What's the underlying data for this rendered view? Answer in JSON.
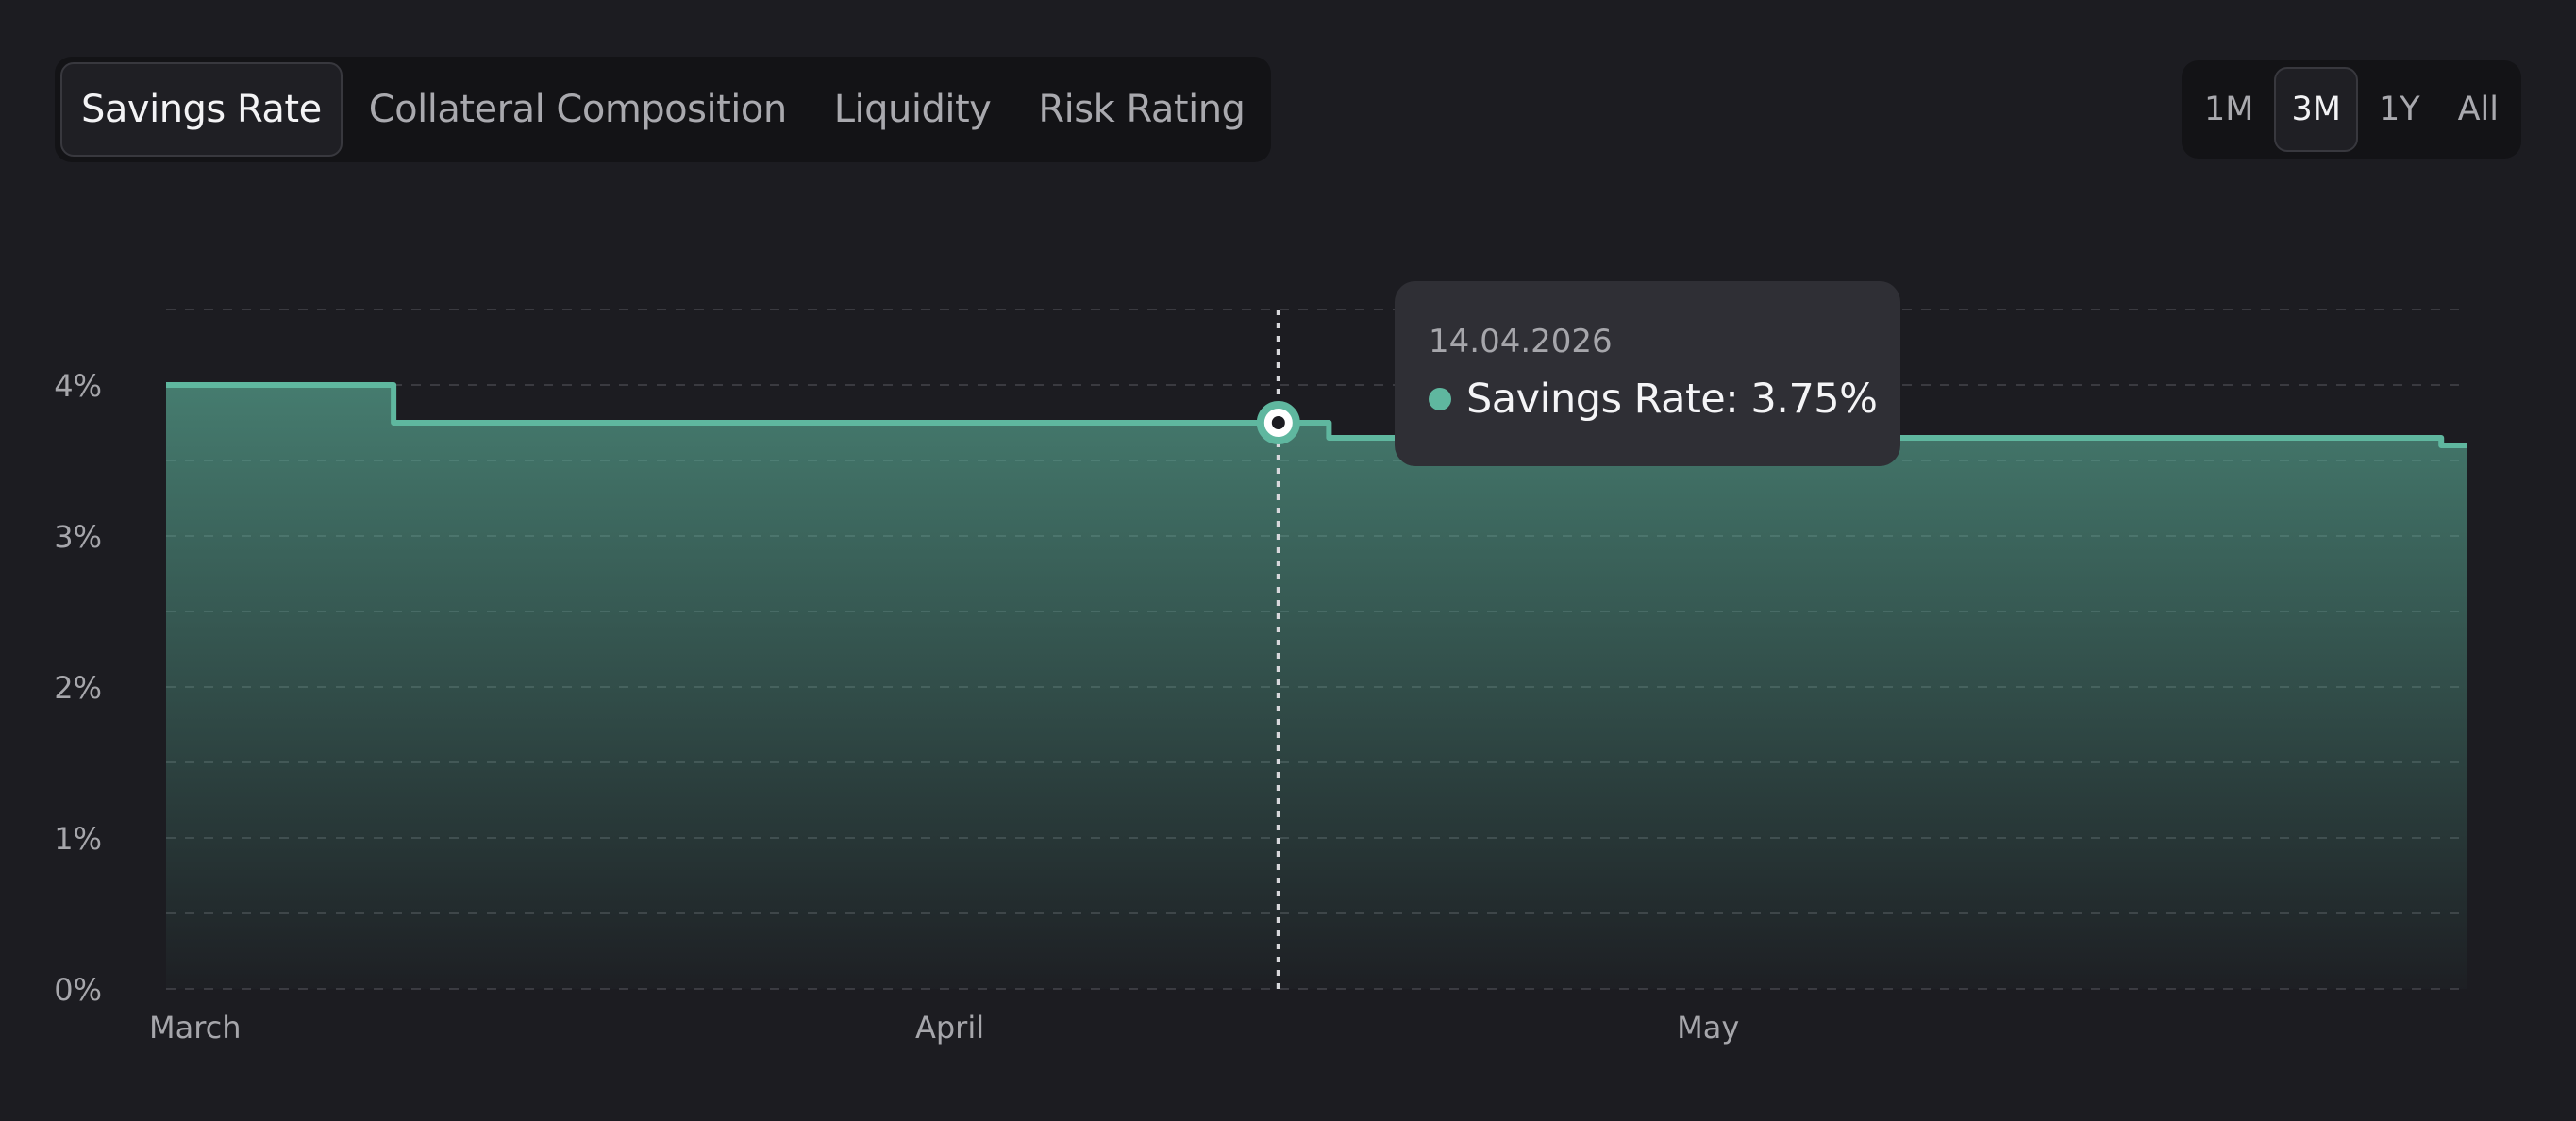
{
  "tabs": [
    {
      "label": "Savings Rate",
      "active": true
    },
    {
      "label": "Collateral Composition",
      "active": false
    },
    {
      "label": "Liquidity",
      "active": false
    },
    {
      "label": "Risk Rating",
      "active": false
    }
  ],
  "ranges": [
    {
      "label": "1M",
      "active": false
    },
    {
      "label": "3M",
      "active": true
    },
    {
      "label": "1Y",
      "active": false
    },
    {
      "label": "All",
      "active": false
    }
  ],
  "tooltip": {
    "date": "14.04.2026",
    "series_label": "Savings Rate",
    "value_text": "3.75%"
  },
  "colors": {
    "line": "#5fb79f",
    "background": "#1c1c21",
    "grid": "#3a3a40",
    "tick_text": "#a6a6ab"
  },
  "chart_data": {
    "type": "area",
    "step": true,
    "xlabel": "",
    "ylabel": "",
    "x_ticks": [
      "March",
      "April",
      "May"
    ],
    "x_tick_dates": [
      "2026-03-01",
      "2026-04-01",
      "2026-05-01"
    ],
    "xlim": [
      "2026-03-01",
      "2026-05-31"
    ],
    "ylim": [
      0,
      4.5
    ],
    "y_ticks": [
      0,
      1,
      2,
      3,
      4
    ],
    "y_tick_labels": [
      "0%",
      "1%",
      "2%",
      "3%",
      "4%"
    ],
    "grid": true,
    "series": [
      {
        "name": "Savings Rate",
        "points": [
          {
            "x": "2026-03-01",
            "y": 4.0
          },
          {
            "x": "2026-03-10",
            "y": 3.75
          },
          {
            "x": "2026-04-15",
            "y": 3.75
          },
          {
            "x": "2026-04-16",
            "y": 3.65
          },
          {
            "x": "2026-05-30",
            "y": 3.65
          },
          {
            "x": "2026-05-30",
            "y": 3.6
          },
          {
            "x": "2026-05-31",
            "y": 3.6
          }
        ]
      }
    ],
    "highlight": {
      "x": "2026-04-14",
      "y": 3.75
    }
  }
}
